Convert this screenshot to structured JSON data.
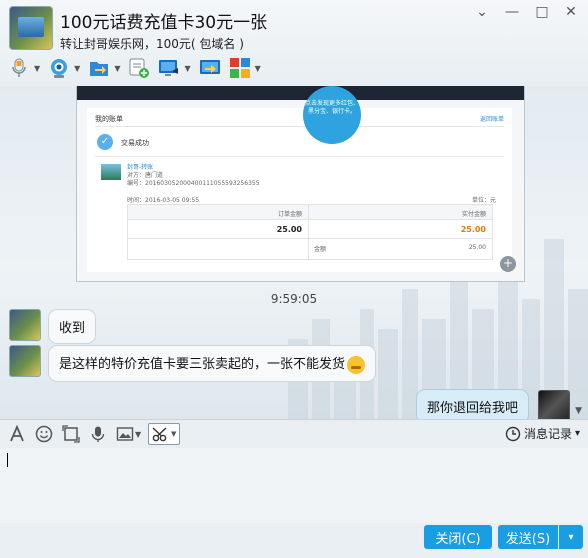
{
  "window": {
    "title": "100元话费充值卡30元一张",
    "subtitle": "转让封哥娱乐网，100元( 包域名 )",
    "controls": {
      "menu": "⌄",
      "minimize": "—",
      "maximize": "□",
      "close": "✕"
    }
  },
  "toolbar": {
    "items": [
      {
        "name": "voice-call",
        "icon": "microphone-icon"
      },
      {
        "name": "video-call",
        "icon": "webcam-icon"
      },
      {
        "name": "file-transfer",
        "icon": "folder-send-icon"
      },
      {
        "name": "new-message",
        "icon": "note-add-icon"
      },
      {
        "name": "remote-desktop",
        "icon": "monitor-icon"
      },
      {
        "name": "screen-share",
        "icon": "share-screen-icon"
      },
      {
        "name": "apps",
        "icon": "apps-grid-icon"
      }
    ]
  },
  "screenshot": {
    "header_left": "我的账单",
    "header_right": "返回账单",
    "ad_text": "点击发现更多红包、黑分宝、银行卡。",
    "status": "交易成功",
    "item_title": "封哥-转账",
    "item_sub1": "对方：唐门道",
    "item_sub2": "编号：201603052000400111055593256355",
    "meta_left": "时间：2016-03-05 09:55",
    "meta_right": "单位：元",
    "col1": "订单金额",
    "col2": "实付金额",
    "amount1": "25.00",
    "amount2": "25.00",
    "row2_label": "金额",
    "row2_value": "25.00"
  },
  "chat": {
    "time": "9:59:05",
    "messages": [
      {
        "from": "contact",
        "text": "收到"
      },
      {
        "from": "contact",
        "text": "是这样的特价充值卡要三张卖起的，一张不能发货"
      },
      {
        "from": "me",
        "text": "那你退回给我吧"
      }
    ]
  },
  "input_toolbar": {
    "history_label": "消息记录",
    "history_caret": "▾"
  },
  "footer": {
    "close_label": "关闭(C)",
    "send_label": "发送(S)",
    "send_caret": "▾"
  },
  "colors": {
    "accent": "#1a9ee3",
    "bubble_me": "#d8ecf8",
    "bubble_contact": "#f7f9fa",
    "amount_orange": "#e8780c"
  }
}
